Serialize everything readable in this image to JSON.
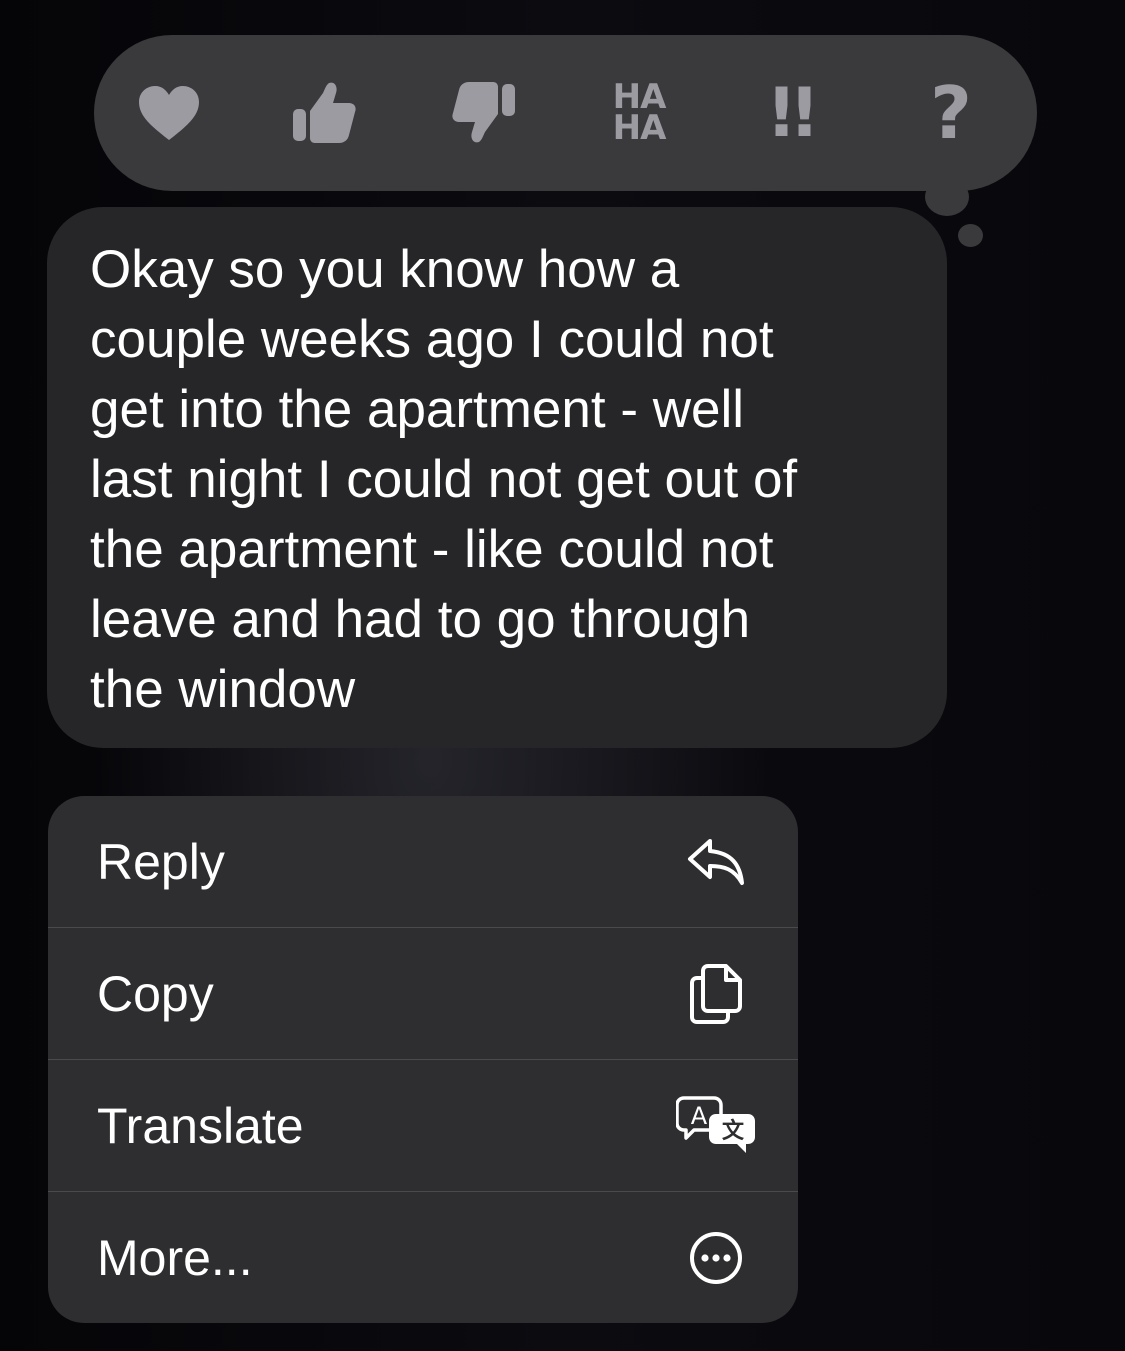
{
  "tapbacks": {
    "heart": "heart-icon",
    "thumbs_up": "thumbs-up-icon",
    "thumbs_down": "thumbs-down-icon",
    "haha_line1": "HA",
    "haha_line2": "HA",
    "exclaim": "!!",
    "question": "?"
  },
  "message": {
    "text": "Okay so you know how a\ncouple weeks ago I could not\nget into the apartment - well\nlast night I could not get out of\nthe apartment - like could not\nleave and had to go through\nthe window"
  },
  "menu": {
    "items": [
      {
        "label": "Reply",
        "icon": "reply-icon"
      },
      {
        "label": "Copy",
        "icon": "copy-icon"
      },
      {
        "label": "Translate",
        "icon": "translate-icon"
      },
      {
        "label": "More...",
        "icon": "more-icon"
      }
    ]
  },
  "colors": {
    "background": "#07070b",
    "bubble": "#262628",
    "tapback_bar": "#3a3a3c",
    "tapback_glyph": "#9b9ba1",
    "menu": "#2e2e30",
    "text": "#ffffff"
  }
}
